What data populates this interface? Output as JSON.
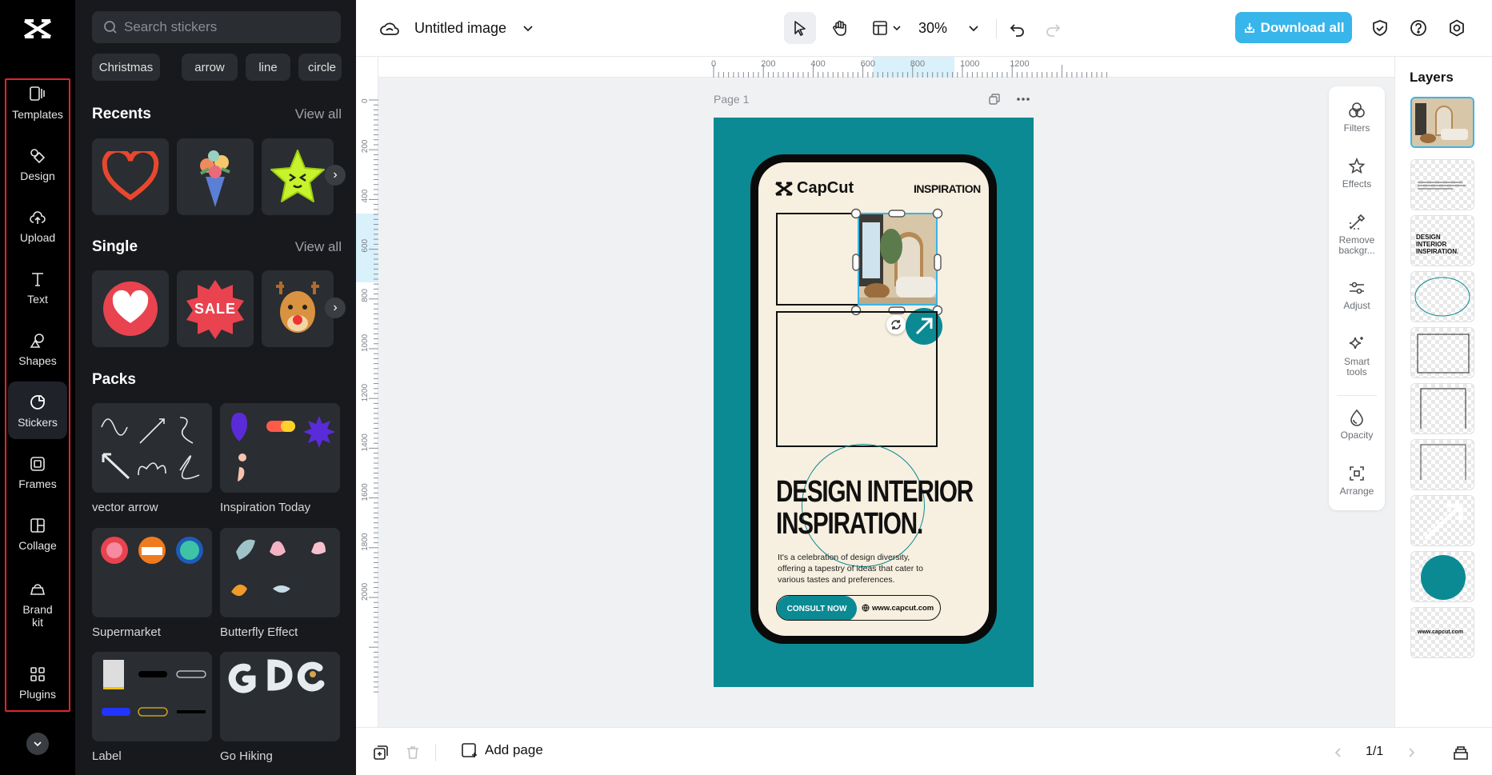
{
  "nav": {
    "items": [
      {
        "label": "Templates"
      },
      {
        "label": "Design"
      },
      {
        "label": "Upload"
      },
      {
        "label": "Text"
      },
      {
        "label": "Shapes"
      },
      {
        "label": "Stickers"
      },
      {
        "label": "Frames"
      },
      {
        "label": "Collage"
      },
      {
        "label": "Brand\nkit"
      },
      {
        "label": "Plugins"
      }
    ],
    "active": "Stickers"
  },
  "panel": {
    "search_placeholder": "Search stickers",
    "chips": [
      "Christmas",
      "arrow",
      "line",
      "circle"
    ],
    "recents": {
      "title": "Recents",
      "view_all": "View all"
    },
    "single": {
      "title": "Single",
      "view_all": "View all",
      "sale_text": "SALE"
    },
    "packs": {
      "title": "Packs",
      "items": [
        {
          "label": "vector arrow"
        },
        {
          "label": "Inspiration Today"
        },
        {
          "label": "Supermarket"
        },
        {
          "label": "Butterfly Effect"
        },
        {
          "label": "Label"
        },
        {
          "label": "Go Hiking"
        }
      ]
    }
  },
  "topbar": {
    "title": "Untitled image",
    "zoom": "30%",
    "download_label": "Download all"
  },
  "ruler": {
    "h_ticks": [
      "0",
      "200",
      "400",
      "600",
      "800",
      "1000",
      "1200"
    ],
    "v_ticks": [
      "0",
      "200",
      "400",
      "600",
      "800",
      "1000",
      "1200",
      "1400",
      "1600",
      "1800",
      "2000"
    ]
  },
  "canvas": {
    "page_label": "Page 1",
    "design": {
      "brand": "CapCut",
      "tag": "INSPIRATION",
      "headline_1": "DESIGN INTERIOR",
      "headline_2": "INSPIRATION.",
      "body_1": "It's a celebration of design diversity,",
      "body_2": "offering a tapestry of ideas that cater to",
      "body_3": "various tastes and preferences.",
      "cta": "CONSULT NOW",
      "url": "www.capcut.com"
    }
  },
  "tools": [
    {
      "label": "Filters"
    },
    {
      "label": "Effects"
    },
    {
      "label": "Remove\nbackgr..."
    },
    {
      "label": "Adjust"
    },
    {
      "label": "Smart\ntools"
    },
    {
      "label": "Opacity"
    },
    {
      "label": "Arrange"
    }
  ],
  "layers": {
    "title": "Layers",
    "thumb_1_text": "DESIGN INTERIOR INSPIRATION.",
    "thumb_2_text": "www.capcut.com"
  },
  "bottombar": {
    "add_page": "Add page",
    "page_count": "1/1"
  },
  "colors": {
    "accent": "#38b5ea",
    "teal": "#0b8a94",
    "cream": "#f7efdf",
    "highlight": "#e3242b"
  }
}
